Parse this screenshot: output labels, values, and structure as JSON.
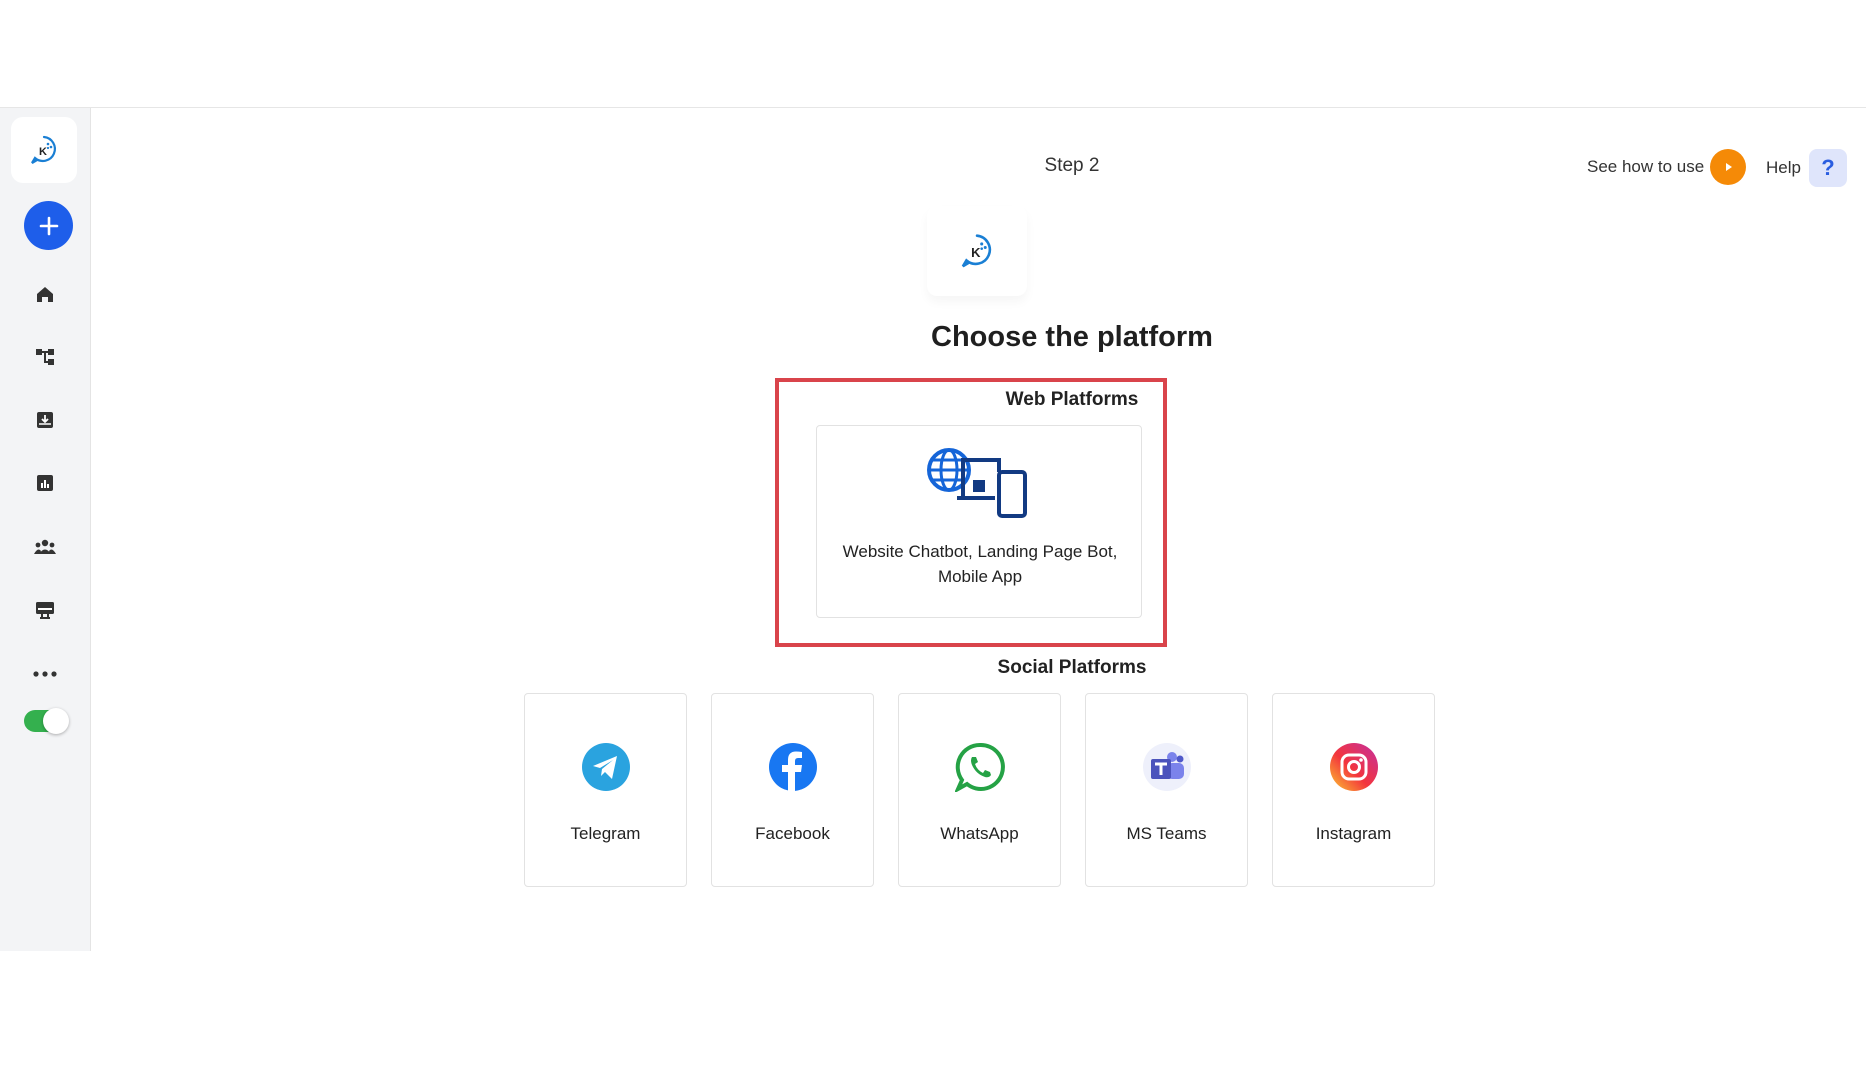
{
  "header": {
    "step": "Step 2",
    "how_to": "See how to use",
    "help": "Help",
    "help_symbol": "?"
  },
  "main": {
    "title": "Choose the platform",
    "web_section": {
      "label": "Web Platforms",
      "card_text": "Website Chatbot, Landing Page Bot, Mobile App"
    },
    "social_section": {
      "label": "Social Platforms",
      "items": [
        {
          "label": "Telegram",
          "icon": "telegram-icon"
        },
        {
          "label": "Facebook",
          "icon": "facebook-icon"
        },
        {
          "label": "WhatsApp",
          "icon": "whatsapp-icon"
        },
        {
          "label": "MS Teams",
          "icon": "ms-teams-icon"
        },
        {
          "label": "Instagram",
          "icon": "instagram-icon"
        }
      ]
    }
  },
  "sidebar": {
    "items": [
      "home-icon",
      "flow-icon",
      "inbox-icon",
      "analytics-icon",
      "users-icon",
      "monitor-icon",
      "more-icon"
    ],
    "toggle_on": true
  },
  "colors": {
    "accent": "#1e5eea",
    "highlight": "#d9444b",
    "play": "#f58a07",
    "toggle": "#34b04e"
  }
}
